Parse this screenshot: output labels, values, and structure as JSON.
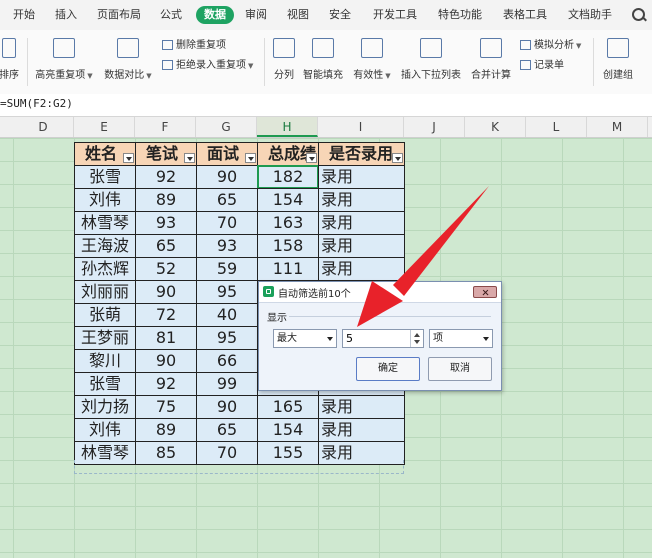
{
  "menu": {
    "items": [
      "开始",
      "插入",
      "页面布局",
      "公式",
      "数据",
      "审阅",
      "视图",
      "安全",
      "开发工具",
      "特色功能",
      "表格工具",
      "文档助手"
    ],
    "active_index": 4
  },
  "ribbon": {
    "sort": "排序",
    "highlight_dup": "高亮重复项",
    "data_compare": "数据对比",
    "remove_dup": "删除重复项",
    "reject_dup": "拒绝录入重复项",
    "split": "分列",
    "smart_fill": "智能填充",
    "validity": "有效性",
    "dropdown": "插入下拉列表",
    "merge_calc": "合并计算",
    "simulate": "模拟分析",
    "record": "记录单",
    "create_group": "创建组"
  },
  "formula_bar": {
    "formula": "=SUM(F2:G2)"
  },
  "columns": [
    "D",
    "E",
    "F",
    "G",
    "H",
    "I",
    "J",
    "K",
    "L",
    "M"
  ],
  "selected_column": "H",
  "table": {
    "headers": [
      "姓名",
      "笔试",
      "面试",
      "总成绩",
      "是否录用"
    ],
    "rows": [
      [
        "张雪",
        "92",
        "90",
        "182",
        "录用"
      ],
      [
        "刘伟",
        "89",
        "65",
        "154",
        "录用"
      ],
      [
        "林雪琴",
        "93",
        "70",
        "163",
        "录用"
      ],
      [
        "王海波",
        "65",
        "93",
        "158",
        "录用"
      ],
      [
        "孙杰辉",
        "52",
        "59",
        "111",
        "录用"
      ],
      [
        "刘丽丽",
        "90",
        "95",
        "",
        ""
      ],
      [
        "张萌",
        "72",
        "40",
        "",
        ""
      ],
      [
        "王梦丽",
        "81",
        "95",
        "",
        ""
      ],
      [
        "黎川",
        "90",
        "66",
        "",
        ""
      ],
      [
        "张雪",
        "92",
        "99",
        "",
        ""
      ],
      [
        "刘力扬",
        "75",
        "90",
        "165",
        "录用"
      ],
      [
        "刘伟",
        "89",
        "65",
        "154",
        "录用"
      ],
      [
        "林雪琴",
        "85",
        "70",
        "155",
        "录用"
      ]
    ]
  },
  "dialog": {
    "title": "自动筛选前10个",
    "group_label": "显示",
    "mode": "最大",
    "count": "5",
    "unit": "项",
    "ok": "确定",
    "cancel": "取消"
  },
  "colors": {
    "accent": "#1ea362",
    "header_fill": "#f7d5b6",
    "body_fill": "#dcebf7",
    "sheet_bg": "#cfe8d0",
    "arrow": "#e8222a"
  }
}
